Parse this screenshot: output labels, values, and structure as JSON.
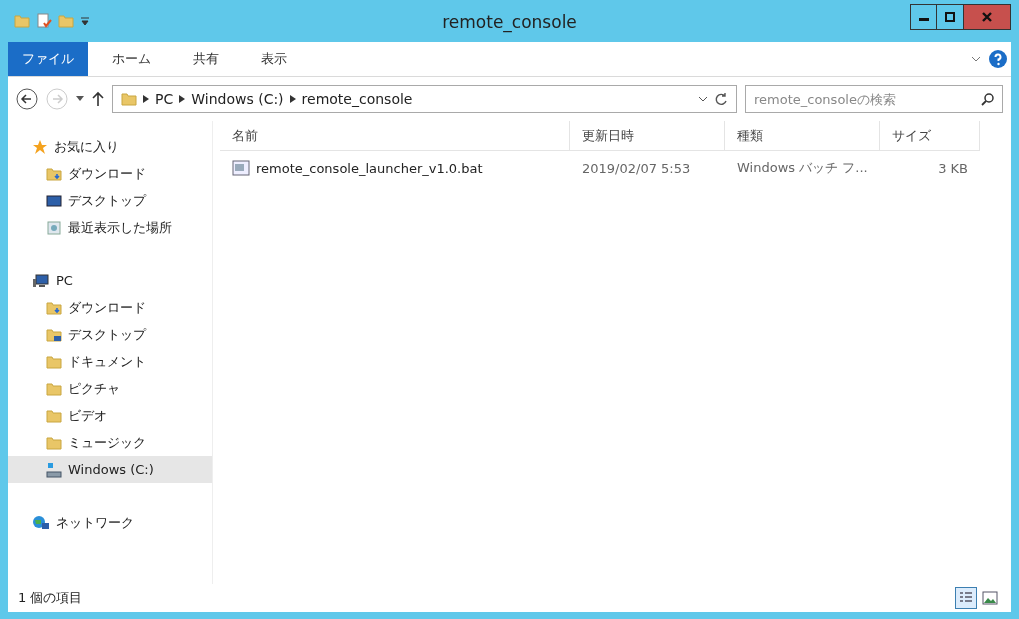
{
  "window": {
    "title": "remote_console"
  },
  "ribbon_tabs": [
    {
      "label": "ファイル",
      "selected": true
    },
    {
      "label": "ホーム",
      "selected": false
    },
    {
      "label": "共有",
      "selected": false
    },
    {
      "label": "表示",
      "selected": false
    }
  ],
  "address": {
    "crumbs": [
      "PC",
      "Windows (C:)",
      "remote_console"
    ]
  },
  "search": {
    "placeholder": "remote_consoleの検索"
  },
  "sidebar": {
    "groups": [
      {
        "label": "お気に入り",
        "kind": "star",
        "selected": false,
        "children": [
          {
            "label": "ダウンロード",
            "kind": "download",
            "selected": false
          },
          {
            "label": "デスクトップ",
            "kind": "desktop",
            "selected": false
          },
          {
            "label": "最近表示した場所",
            "kind": "recent",
            "selected": false
          }
        ]
      },
      {
        "label": "PC",
        "kind": "pc",
        "selected": false,
        "children": [
          {
            "label": "ダウンロード",
            "kind": "download",
            "selected": false
          },
          {
            "label": "デスクトップ",
            "kind": "desktop-folder",
            "selected": false
          },
          {
            "label": "ドキュメント",
            "kind": "folder",
            "selected": false
          },
          {
            "label": "ピクチャ",
            "kind": "folder",
            "selected": false
          },
          {
            "label": "ビデオ",
            "kind": "folder",
            "selected": false
          },
          {
            "label": "ミュージック",
            "kind": "folder",
            "selected": false
          },
          {
            "label": "Windows (C:)",
            "kind": "drive",
            "selected": true
          }
        ]
      },
      {
        "label": "ネットワーク",
        "kind": "network",
        "selected": false
      }
    ]
  },
  "table": {
    "columns": [
      "名前",
      "更新日時",
      "種類",
      "サイズ"
    ],
    "rows": [
      {
        "name": "remote_console_launcher_v1.0.bat",
        "modified": "2019/02/07 5:53",
        "type": "Windows バッチ フ...",
        "size": "3 KB"
      }
    ]
  },
  "status_bar": {
    "text": "1 個の項目"
  },
  "view_buttons": [
    {
      "kind": "details",
      "selected": true
    },
    {
      "kind": "large-icons",
      "selected": false
    }
  ]
}
